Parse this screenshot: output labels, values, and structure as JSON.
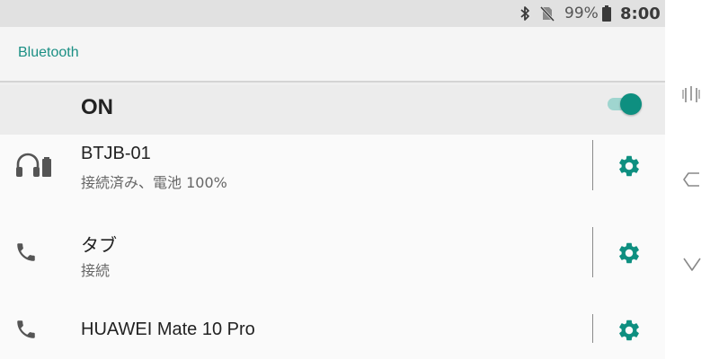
{
  "status_bar": {
    "bluetooth_icon": "bluetooth-icon",
    "sim_icon": "no-sim-icon",
    "battery_percent": "99%",
    "battery_icon": "battery-icon",
    "time": "8:00"
  },
  "app_bar": {
    "title": "Bluetooth"
  },
  "master_switch": {
    "label": "ON",
    "state": "on",
    "accent_color": "#0e8f80"
  },
  "devices": [
    {
      "icon": "headset-icon",
      "name": "BTJB-01",
      "status": "接続済み、電池 100%"
    },
    {
      "icon": "phone-icon",
      "name": "タブ",
      "status": "接続"
    },
    {
      "icon": "phone-icon",
      "name": "HUAWEI Mate 10 Pro",
      "status": ""
    }
  ],
  "device_settings_icon": "settings-gear-icon",
  "nav_bar": {
    "buttons": [
      "recents-icon",
      "back-icon",
      "hide-keyboard-icon"
    ]
  }
}
